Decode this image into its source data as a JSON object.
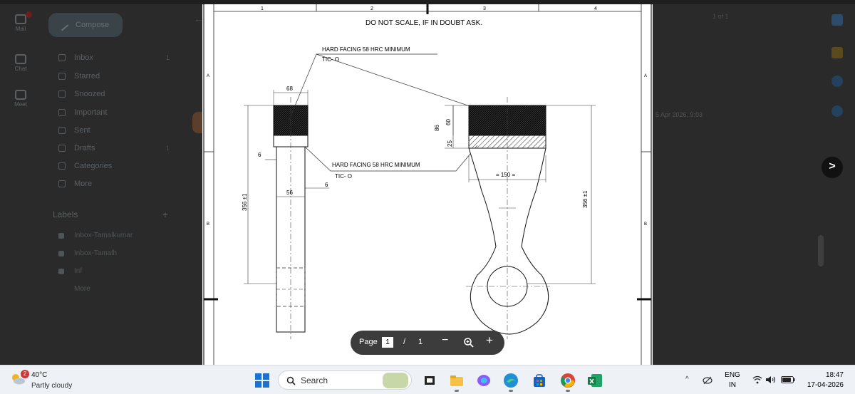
{
  "gmail": {
    "rail": [
      {
        "label": "Mail"
      },
      {
        "label": "Chat"
      },
      {
        "label": "Meet"
      }
    ],
    "compose_label": "Compose",
    "nav": [
      {
        "label": "Inbox",
        "count": "1"
      },
      {
        "label": "Starred",
        "count": ""
      },
      {
        "label": "Snoozed",
        "count": ""
      },
      {
        "label": "Important",
        "count": ""
      },
      {
        "label": "Sent",
        "count": ""
      },
      {
        "label": "Drafts",
        "count": "1"
      },
      {
        "label": "Categories",
        "count": ""
      },
      {
        "label": "More",
        "count": ""
      }
    ],
    "labels_heading": "Labels",
    "labels": [
      {
        "label": "Inbox-Tamalkumar"
      },
      {
        "label": "Inbox-Tamalh"
      },
      {
        "label": "Inf"
      },
      {
        "label": "More"
      }
    ],
    "mail_date": "5 Apr 2026, 9:03",
    "pager": "1 of 1"
  },
  "pdf": {
    "header": "DO NOT SCALE, IF IN DOUBT ASK.",
    "zones_top": [
      "1",
      "2",
      "3",
      "4"
    ],
    "zones_side": [
      "A",
      "B"
    ],
    "note1": "HARD FACING 58 HRC MINIMUM",
    "note1_sub": "TIC- O",
    "note2": "HARD FACING 58 HRC MINIMUM",
    "note2_sub": "TIC- O",
    "dims": {
      "d68": "68",
      "d6a": "6",
      "d56": "56",
      "d6b": "6",
      "d356_left": "356 ±1",
      "d86": "86",
      "d60": "60",
      "d25": "25",
      "d150": "= 150 =",
      "d356_right": "356 ±1"
    }
  },
  "toolbar": {
    "page_label": "Page",
    "page_current": "1",
    "separator": "/",
    "page_total": "1",
    "minus": "−",
    "plus": "+"
  },
  "next_label": ">",
  "taskbar": {
    "weather_badge": "2",
    "temperature": "40°C",
    "condition": "Partly cloudy",
    "search_label": "Search",
    "lang_top": "ENG",
    "lang_bottom": "IN",
    "time": "18:47",
    "date": "17-04-2026"
  },
  "colors": {
    "accent_red": "#d13438",
    "toolbar_bg": "#3c3c3c",
    "hatch": "#111111"
  }
}
